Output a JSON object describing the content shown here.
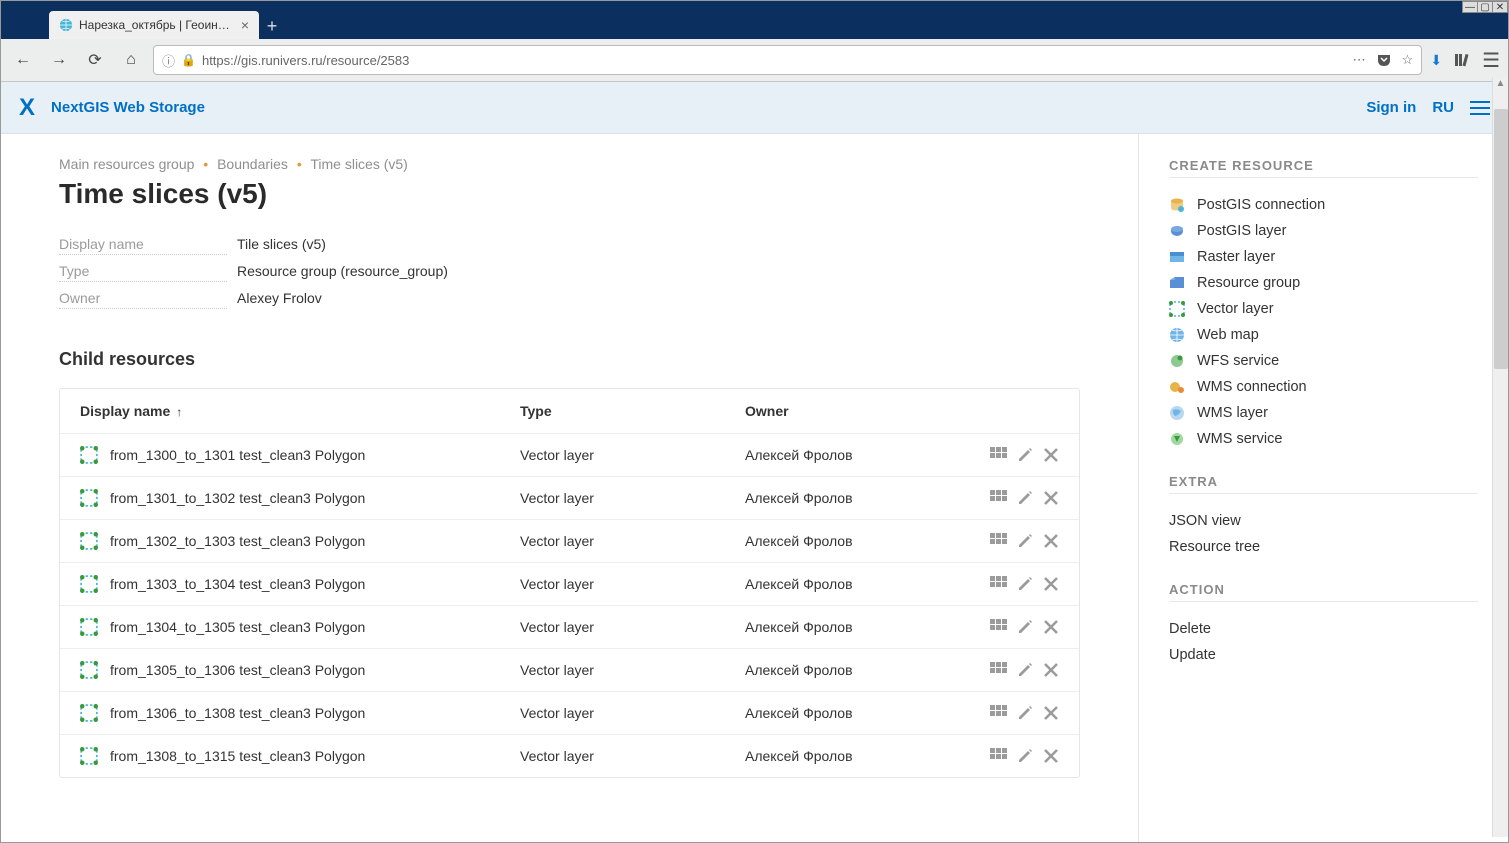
{
  "browser": {
    "tab_title": "Нарезка_октябрь | Геоинформа",
    "url": "https://gis.runivers.ru/resource/2583"
  },
  "header": {
    "app_title": "NextGIS Web Storage",
    "sign_in": "Sign in",
    "lang": "RU"
  },
  "breadcrumb": [
    "Main resources group",
    "Boundaries",
    "Time slices (v5)"
  ],
  "page_title": "Time slices (v5)",
  "meta": {
    "display_name_label": "Display name",
    "display_name_value": "Tile slices (v5)",
    "type_label": "Type",
    "type_value": "Resource group (resource_group)",
    "owner_label": "Owner",
    "owner_value": "Alexey Frolov"
  },
  "child": {
    "title": "Child resources",
    "columns": {
      "name": "Display name",
      "type": "Type",
      "owner": "Owner"
    },
    "rows": [
      {
        "name": "from_1300_to_1301 test_clean3 Polygon",
        "type": "Vector layer",
        "owner": "Алексей Фролов"
      },
      {
        "name": "from_1301_to_1302 test_clean3 Polygon",
        "type": "Vector layer",
        "owner": "Алексей Фролов"
      },
      {
        "name": "from_1302_to_1303 test_clean3 Polygon",
        "type": "Vector layer",
        "owner": "Алексей Фролов"
      },
      {
        "name": "from_1303_to_1304 test_clean3 Polygon",
        "type": "Vector layer",
        "owner": "Алексей Фролов"
      },
      {
        "name": "from_1304_to_1305 test_clean3 Polygon",
        "type": "Vector layer",
        "owner": "Алексей Фролов"
      },
      {
        "name": "from_1305_to_1306 test_clean3 Polygon",
        "type": "Vector layer",
        "owner": "Алексей Фролов"
      },
      {
        "name": "from_1306_to_1308 test_clean3 Polygon",
        "type": "Vector layer",
        "owner": "Алексей Фролов"
      },
      {
        "name": "from_1308_to_1315 test_clean3 Polygon",
        "type": "Vector layer",
        "owner": "Алексей Фролов"
      }
    ]
  },
  "sidebar": {
    "create_heading": "CREATE RESOURCE",
    "create": [
      "PostGIS connection",
      "PostGIS layer",
      "Raster layer",
      "Resource group",
      "Vector layer",
      "Web map",
      "WFS service",
      "WMS connection",
      "WMS layer",
      "WMS service"
    ],
    "extra_heading": "EXTRA",
    "extra": [
      "JSON view",
      "Resource tree"
    ],
    "action_heading": "ACTION",
    "action": [
      "Delete",
      "Update"
    ]
  }
}
